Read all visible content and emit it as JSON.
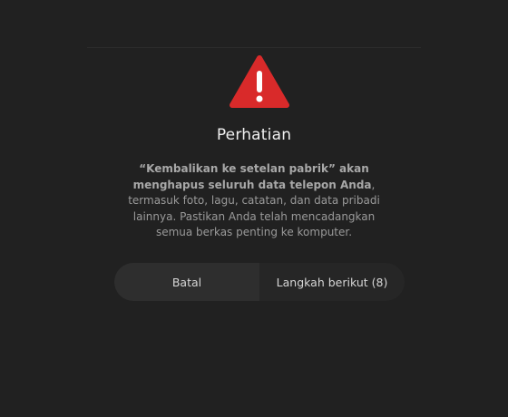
{
  "dialog": {
    "icon": "warning-icon",
    "title": "Perhatian",
    "message": {
      "bold_part": "“Kembalikan ke setelan pabrik” akan menghapus seluruh data telepon Anda",
      "rest": ", termasuk foto, lagu, catatan, dan data pribadi lainnya. Pastikan Anda telah mencadangkan semua berkas penting ke komputer."
    },
    "cancel_label": "Batal",
    "next_label": "Langkah berikut (8)"
  },
  "colors": {
    "background": "#212121",
    "warning": "#d92a2a",
    "button_left": "#2e2e2e",
    "button_right": "#262626"
  }
}
